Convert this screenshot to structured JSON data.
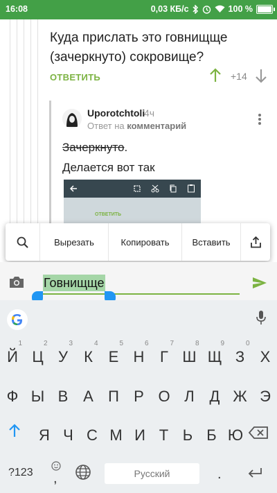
{
  "status": {
    "time": "16:08",
    "speed": "0,03 КБ/с",
    "battery": "100 %"
  },
  "thread": {
    "parent_comment": "Куда прислать это говнищще (зачеркнуто) сокровище?",
    "reply_label": "ОТВЕТИТЬ",
    "score": "+14",
    "reply": {
      "username": "Uporotchtoli",
      "time": "4ч",
      "meta_prefix": "Ответ на",
      "meta_link": "комментарий",
      "strike_text": "Зачеркнуто",
      "strike_after": ".",
      "line2": "Делается вот так",
      "embedded_label": "ОТВЕТИТЬ"
    }
  },
  "popup": {
    "cut": "Вырезать",
    "copy": "Копировать",
    "paste": "Вставить"
  },
  "input": {
    "value": "Говнищще"
  },
  "keyboard": {
    "row1": [
      {
        "k": "Й",
        "h": "1"
      },
      {
        "k": "Ц",
        "h": "2"
      },
      {
        "k": "У",
        "h": "3"
      },
      {
        "k": "К",
        "h": "4"
      },
      {
        "k": "Е",
        "h": "5"
      },
      {
        "k": "Н",
        "h": "6"
      },
      {
        "k": "Г",
        "h": "7"
      },
      {
        "k": "Ш",
        "h": "8"
      },
      {
        "k": "Щ",
        "h": "9"
      },
      {
        "k": "З",
        "h": "0"
      },
      {
        "k": "Х",
        "h": ""
      }
    ],
    "row2": [
      "Ф",
      "Ы",
      "В",
      "А",
      "П",
      "Р",
      "О",
      "Л",
      "Д",
      "Ж",
      "Э"
    ],
    "row3": [
      "Я",
      "Ч",
      "С",
      "М",
      "И",
      "Т",
      "Ь",
      "Б",
      "Ю"
    ],
    "symbols_key": "?123",
    "space_label": "Русский",
    "accent_color": "#7cb342",
    "shift_color": "#2196f3"
  }
}
